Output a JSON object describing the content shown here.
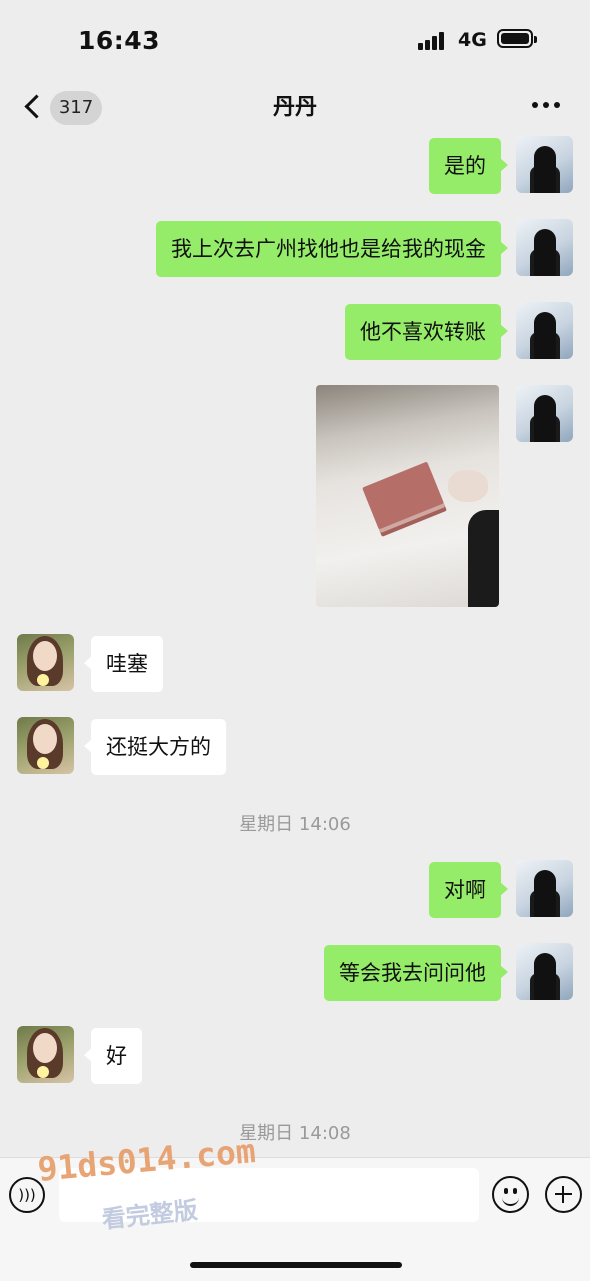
{
  "status_bar": {
    "time": "16:43",
    "network": "4G"
  },
  "nav": {
    "back_count": "317",
    "title": "丹丹"
  },
  "messages": [
    {
      "side": "out",
      "text": "是的"
    },
    {
      "side": "out",
      "text": "我上次去广州找他也是给我的现金"
    },
    {
      "side": "out",
      "text": "他不喜欢转账"
    },
    {
      "side": "out",
      "type": "image",
      "content": "photo-cash-on-bed"
    },
    {
      "side": "in",
      "text": "哇塞"
    },
    {
      "side": "in",
      "text": "还挺大方的"
    },
    {
      "type": "timestamp",
      "text": "星期日 14:06"
    },
    {
      "side": "out",
      "text": "对啊"
    },
    {
      "side": "out",
      "text": "等会我去问问他"
    },
    {
      "side": "in",
      "text": "好"
    },
    {
      "type": "timestamp",
      "text": "星期日 14:08"
    }
  ],
  "input": {
    "value": "",
    "placeholder": ""
  },
  "watermark": {
    "line1": "91ds014.com",
    "line2": "看完整版"
  },
  "colors": {
    "outgoing_bubble": "#95ec69",
    "incoming_bubble": "#ffffff",
    "background": "#ededed"
  },
  "icons": [
    "back-chevron-icon",
    "more-icon",
    "voice-icon",
    "emoji-icon",
    "plus-icon"
  ]
}
